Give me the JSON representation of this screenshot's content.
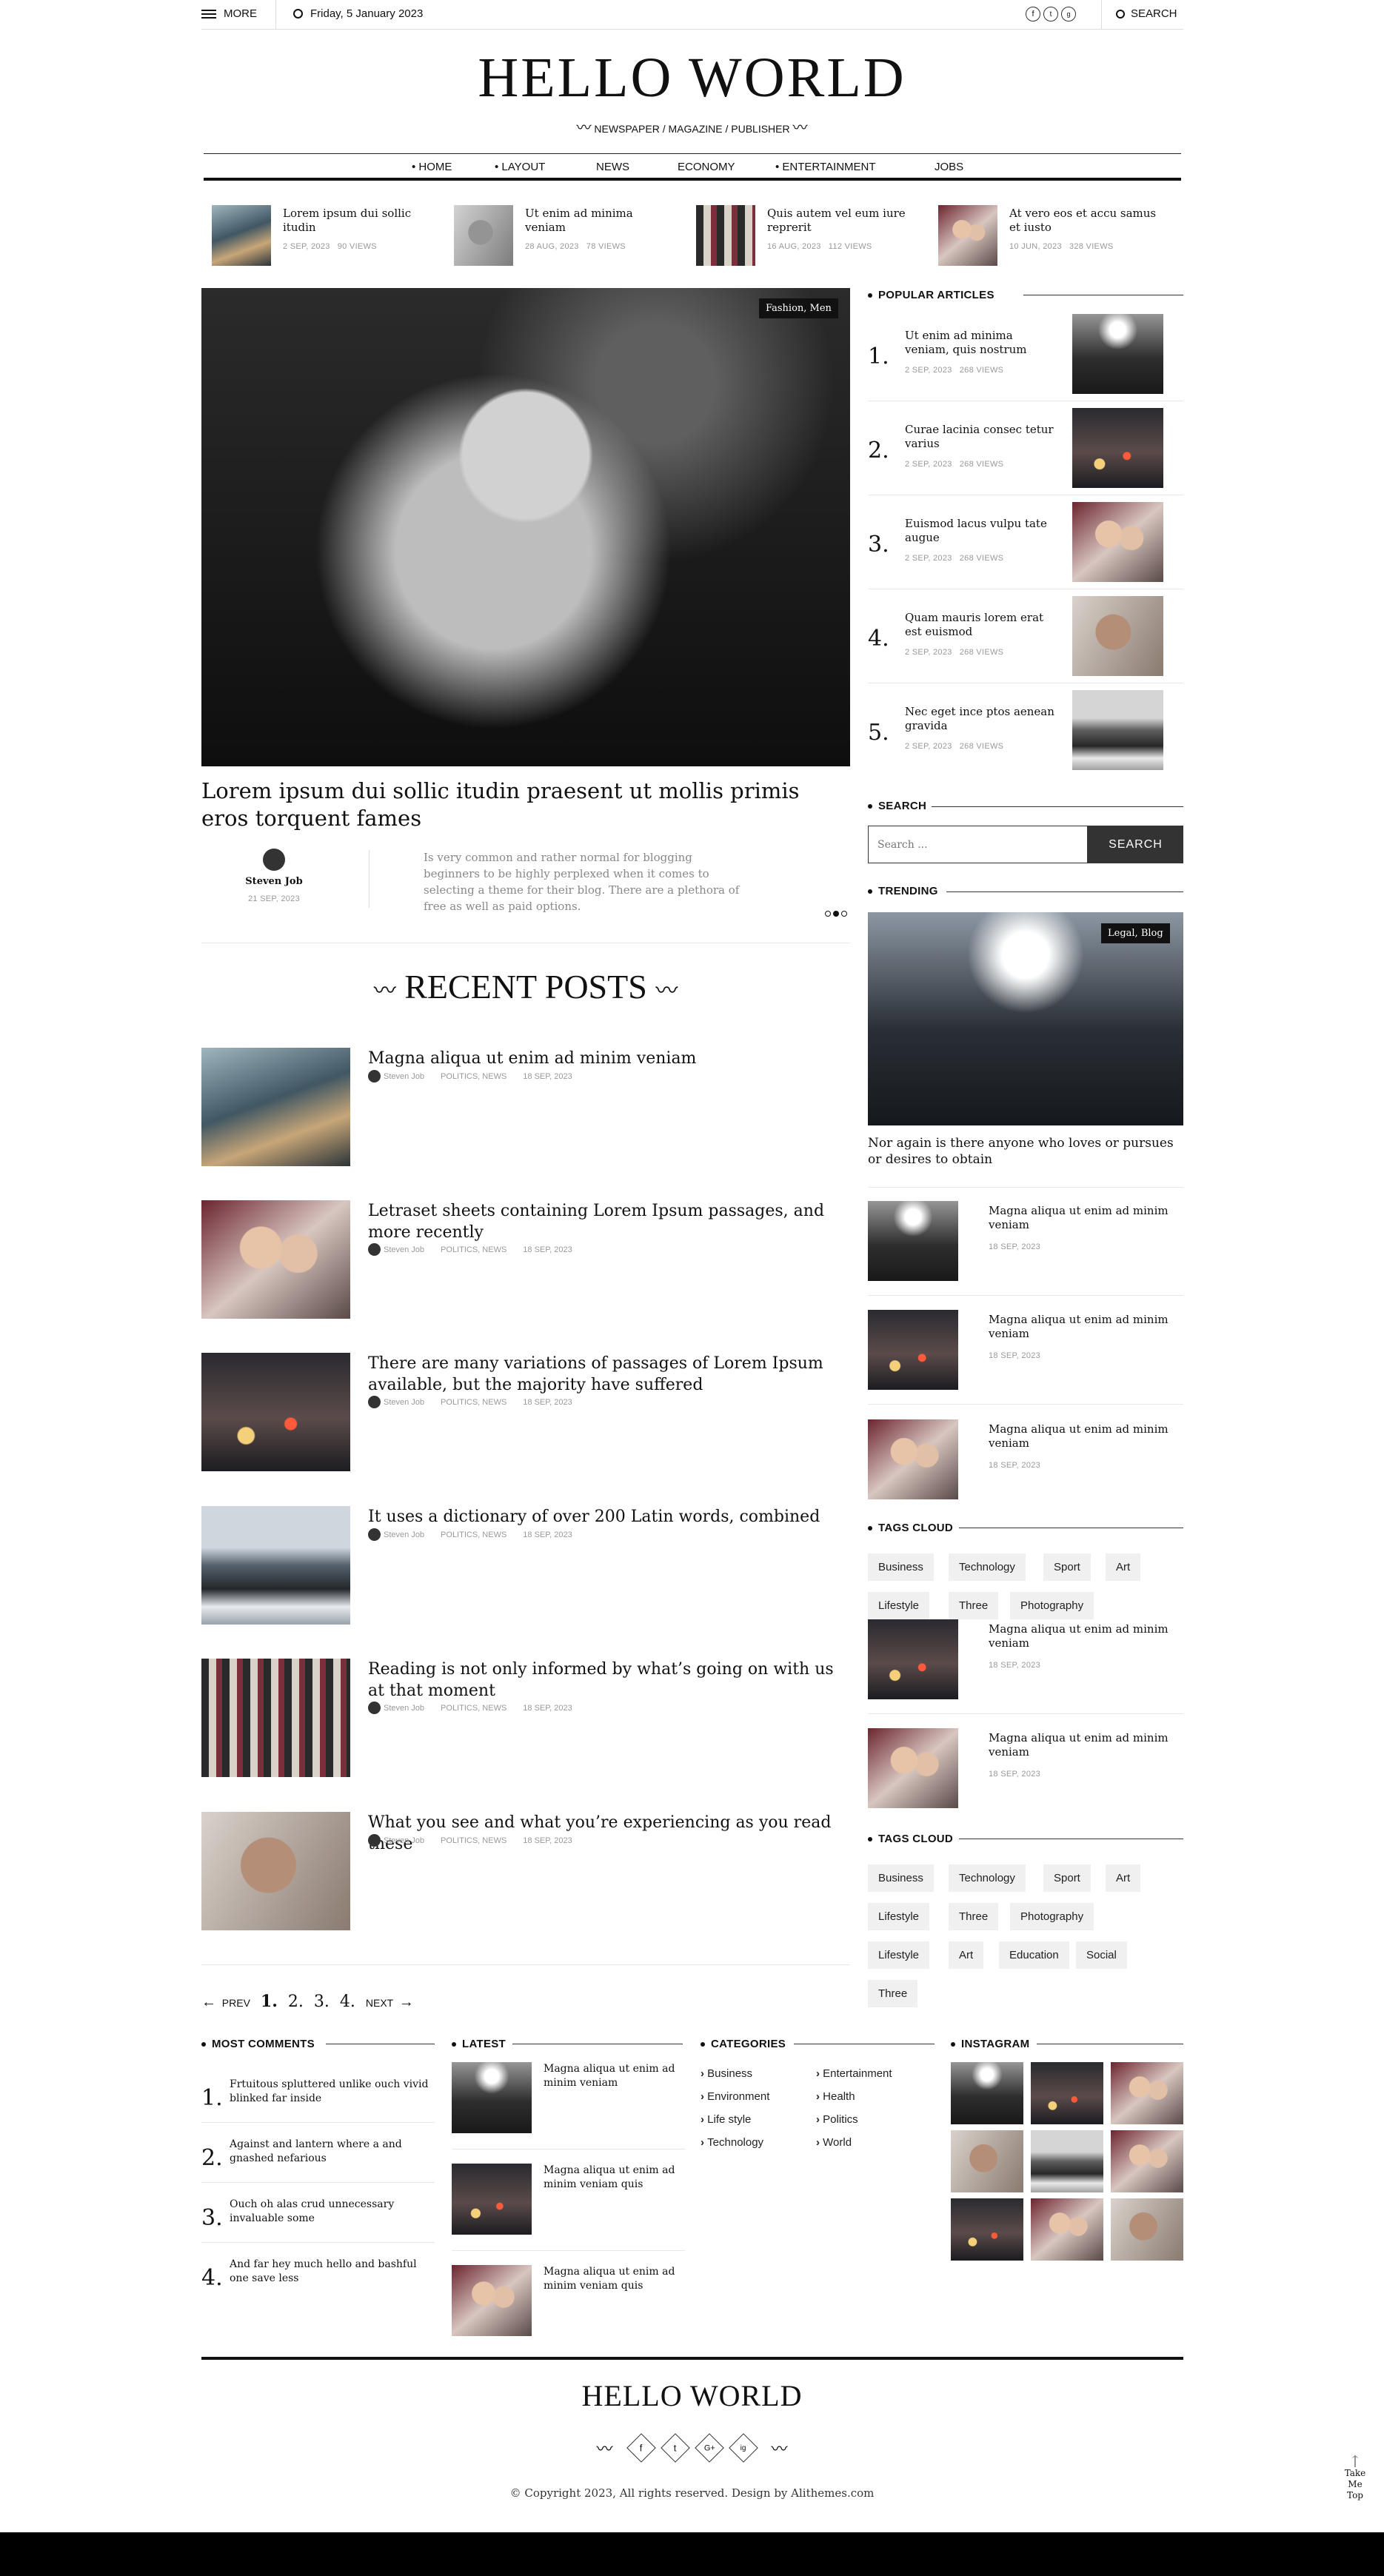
{
  "topbar": {
    "more": "MORE",
    "date": "Friday, 5 January 2023",
    "search": "SEARCH"
  },
  "site": {
    "title": "HELLO WORLD",
    "tagline": "NEWSPAPER / MAGAZINE / PUBLISHER"
  },
  "nav": [
    "HOME",
    "LAYOUT",
    "NEWS",
    "ECONOMY",
    "ENTERTAINMENT",
    "JOBS"
  ],
  "ticker": [
    {
      "title": "Lorem ipsum dui sollic itudin",
      "date": "2 SEP, 2023",
      "views": "90 VIEWS"
    },
    {
      "title": "Ut enim ad minima veniam",
      "date": "28 AUG, 2023",
      "views": "78 VIEWS"
    },
    {
      "title": "Quis autem vel eum iure reprerit",
      "date": "16 AUG, 2023",
      "views": "112 VIEWS"
    },
    {
      "title": "At vero eos et accu samus et iusto",
      "date": "10 JUN, 2023",
      "views": "328 VIEWS"
    }
  ],
  "feature": {
    "badge": "Fashion, Men",
    "title": "Lorem ipsum dui sollic itudin praesent ut mollis primis eros torquent fames",
    "author": "Steven Job",
    "date": "21 SEP, 2023",
    "excerpt": "Is very common and rather normal for blogging beginners to be highly perplexed when it comes to selecting a theme for their blog. There are a plethora of free as well as paid options."
  },
  "recent": {
    "title": "RECENT POSTS",
    "items": [
      {
        "title": "Magna aliqua ut enim ad minim veniam",
        "author": "Steven Job",
        "cats": "POLITICS, NEWS",
        "date": "18 SEP, 2023"
      },
      {
        "title": "Letraset sheets containing Lorem Ipsum passages, and more recently",
        "author": "Steven Job",
        "cats": "POLITICS, NEWS",
        "date": "18 SEP, 2023"
      },
      {
        "title": "There are many variations of passages of Lorem Ipsum available, but the majority have suffered",
        "author": "Steven Job",
        "cats": "POLITICS, NEWS",
        "date": "18 SEP, 2023"
      },
      {
        "title": "It uses a dictionary of over 200 Latin words, combined",
        "author": "Steven Job",
        "cats": "POLITICS, NEWS",
        "date": "18 SEP, 2023"
      },
      {
        "title": "Reading is not only informed by what’s going on with us at that moment",
        "author": "Steven Job",
        "cats": "POLITICS, NEWS",
        "date": "18 SEP, 2023"
      },
      {
        "title": "What you see and what you’re experiencing as you read these",
        "author": "Steven Job",
        "cats": "POLITICS, NEWS",
        "date": "18 SEP, 2023"
      }
    ]
  },
  "pagination": {
    "prev": "PREV",
    "pages": [
      "1.",
      "2.",
      "3.",
      "4."
    ],
    "next": "NEXT"
  },
  "popular": {
    "title": "POPULAR ARTICLES",
    "items": [
      {
        "n": "1.",
        "title": "Ut enim ad minima veniam, quis nostrum",
        "date": "2 SEP, 2023",
        "views": "268 VIEWS"
      },
      {
        "n": "2.",
        "title": "Curae lacinia consec tetur varius",
        "date": "2 SEP, 2023",
        "views": "268 VIEWS"
      },
      {
        "n": "3.",
        "title": "Euismod lacus vulpu tate augue",
        "date": "2 SEP, 2023",
        "views": "268 VIEWS"
      },
      {
        "n": "4.",
        "title": "Quam mauris lorem erat est euismod",
        "date": "2 SEP, 2023",
        "views": "268 VIEWS"
      },
      {
        "n": "5.",
        "title": "Nec eget ince ptos aenean gravida",
        "date": "2 SEP, 2023",
        "views": "268 VIEWS"
      }
    ]
  },
  "search": {
    "title": "SEARCH",
    "placeholder": "Search ...",
    "button": "SEARCH"
  },
  "trending": {
    "title": "TRENDING",
    "badge": "Legal, Blog",
    "headline": "Nor again is there anyone who loves or pursues or desires to obtain",
    "items": [
      {
        "title": "Magna aliqua ut enim ad minim veniam",
        "date": "18 SEP, 2023"
      },
      {
        "title": "Magna aliqua ut enim ad minim veniam",
        "date": "18 SEP, 2023"
      },
      {
        "title": "Magna aliqua ut enim ad minim veniam",
        "date": "18 SEP, 2023"
      },
      {
        "title": "Magna aliqua ut enim ad minim veniam",
        "date": "18 SEP, 2023"
      },
      {
        "title": "Magna aliqua ut enim ad minim veniam",
        "date": "18 SEP, 2023"
      }
    ]
  },
  "tags1": {
    "title": "TAGS CLOUD",
    "items": [
      "Business",
      "Technology",
      "Sport",
      "Art",
      "Lifestyle",
      "Three",
      "Photography"
    ]
  },
  "tags2": {
    "title": "TAGS CLOUD",
    "items": [
      "Business",
      "Technology",
      "Sport",
      "Art",
      "Lifestyle",
      "Three",
      "Photography",
      "Lifestyle",
      "Art",
      "Education",
      "Social",
      "Three"
    ]
  },
  "most_comments": {
    "title": "MOST COMMENTS",
    "items": [
      {
        "n": "1.",
        "title": "Frtuitous spluttered unlike ouch vivid blinked far inside"
      },
      {
        "n": "2.",
        "title": "Against and lantern where a and gnashed nefarious"
      },
      {
        "n": "3.",
        "title": "Ouch oh alas crud unnecessary invaluable some"
      },
      {
        "n": "4.",
        "title": "And far hey much hello and bashful one save less"
      }
    ]
  },
  "latest": {
    "title": "LATEST",
    "items": [
      {
        "title": "Magna aliqua ut enim ad minim veniam"
      },
      {
        "title": "Magna aliqua ut enim ad minim veniam quis"
      },
      {
        "title": "Magna aliqua ut enim ad minim veniam quis"
      }
    ]
  },
  "categories": {
    "title": "CATEGORIES",
    "col1": [
      "Business",
      "Environment",
      "Life style",
      "Technology"
    ],
    "col2": [
      "Entertainment",
      "Health",
      "Politics",
      "World"
    ]
  },
  "instagram": {
    "title": "INSTAGRAM"
  },
  "footer": {
    "title": "HELLO WORLD",
    "copyright": "© Copyright 2023, All rights reserved. Design by Alithemes.com",
    "social": [
      "f",
      "t",
      "G+",
      "ig"
    ],
    "totop": "Take Me Top"
  }
}
